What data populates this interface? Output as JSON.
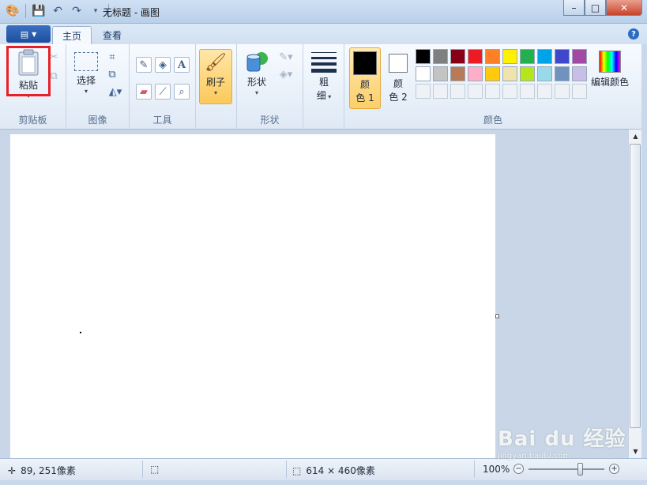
{
  "window": {
    "title": "无标题 - 画图"
  },
  "tabs": {
    "home": "主页",
    "view": "查看"
  },
  "groups": {
    "clipboard": {
      "label": "剪贴板",
      "paste": "粘贴"
    },
    "image": {
      "label": "图像",
      "select": "选择"
    },
    "tools": {
      "label": "工具"
    },
    "brushes": {
      "label": "刷子"
    },
    "shapes": {
      "label": "形状",
      "shapes": "形状"
    },
    "size": {
      "line1": "粗",
      "line2": "细"
    },
    "colors": {
      "label": "颜色",
      "color1_l1": "颜",
      "color1_l2": "色 1",
      "color2_l1": "颜",
      "color2_l2": "色 2",
      "edit": "编辑颜色"
    }
  },
  "palette": {
    "row1": [
      "#000000",
      "#7f7f7f",
      "#880015",
      "#ed1c24",
      "#ff7f27",
      "#fff200",
      "#22b14c",
      "#00a2e8",
      "#3f48cc",
      "#a349a4"
    ],
    "row2": [
      "#ffffff",
      "#c3c3c3",
      "#b97a57",
      "#ffaec9",
      "#ffc90e",
      "#efe4b0",
      "#b5e61d",
      "#99d9ea",
      "#7092be",
      "#c8bfe7"
    ],
    "color1": "#000000",
    "color2": "#ffffff"
  },
  "status": {
    "cursor": "89, 251像素",
    "canvas_size": "614 × 460像素",
    "zoom": "100%"
  },
  "watermark": {
    "brand": "Bai du 经验",
    "url": "jingyan.baidu.com"
  }
}
